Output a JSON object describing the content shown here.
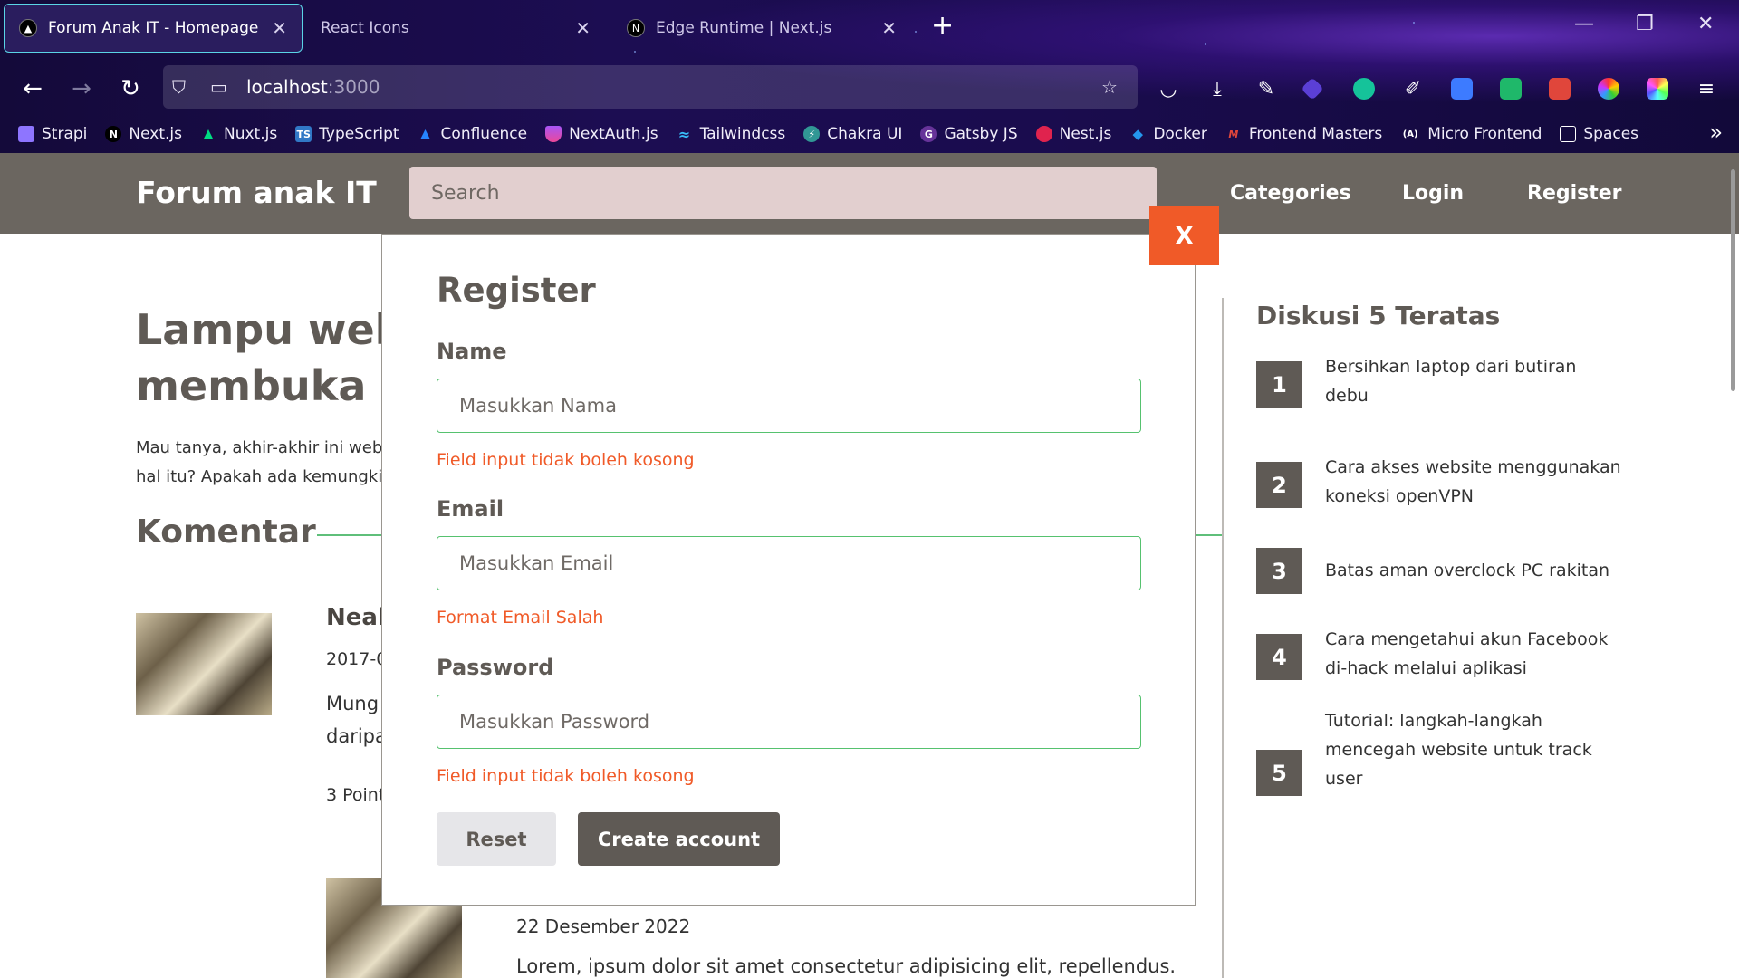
{
  "browser": {
    "tabs": [
      {
        "title": "Forum Anak IT - Homepage",
        "active": true
      },
      {
        "title": "React Icons",
        "active": false
      },
      {
        "title": "Edge Runtime | Next.js",
        "active": false
      }
    ],
    "url_host": "localhost",
    "url_port": ":3000",
    "bookmarks": [
      {
        "label": "Strapi",
        "icon": "strapi-icon",
        "color": "#8e75ff"
      },
      {
        "label": "Next.js",
        "icon": "nextjs-icon",
        "color": "#000000"
      },
      {
        "label": "Nuxt.js",
        "icon": "nuxt-icon",
        "color": "#00dc82"
      },
      {
        "label": "TypeScript",
        "icon": "typescript-icon",
        "color": "#3178c6"
      },
      {
        "label": "Confluence",
        "icon": "confluence-icon",
        "color": "#2684ff"
      },
      {
        "label": "NextAuth.js",
        "icon": "nextauth-icon",
        "color": "#a855f7"
      },
      {
        "label": "Tailwindcss",
        "icon": "tailwind-icon",
        "color": "#38bdf8"
      },
      {
        "label": "Chakra UI",
        "icon": "chakra-icon",
        "color": "#319795"
      },
      {
        "label": "Gatsby JS",
        "icon": "gatsby-icon",
        "color": "#663399"
      },
      {
        "label": "Nest.js",
        "icon": "nestjs-icon",
        "color": "#e0234e"
      },
      {
        "label": "Docker",
        "icon": "docker-icon",
        "color": "#2496ed"
      },
      {
        "label": "Frontend Masters",
        "icon": "frontend-masters-icon",
        "color": "#c02d28"
      },
      {
        "label": "Micro Frontend",
        "icon": "micro-frontend-icon",
        "color": "#444444"
      },
      {
        "label": "Spaces",
        "icon": "folder-icon",
        "color": "#ffffff"
      }
    ]
  },
  "site": {
    "brand": "Forum anak IT",
    "search_placeholder": "Search",
    "nav": [
      "Categories",
      "Login",
      "Register"
    ]
  },
  "article": {
    "title_line1": "Lampu webca",
    "title_line2": "membuka apl",
    "body_line1": "Mau tanya, akhir-akhir ini web",
    "body_line2": "hal itu? Apakah ada kemungki"
  },
  "comments": {
    "heading": "Komentar",
    "first": {
      "name": "Neal",
      "date": "2017-0",
      "text_line1": "Mung",
      "text_line2": "daripa",
      "points": "3 Point"
    },
    "second": {
      "date": "22 Desember 2022",
      "text": "Lorem, ipsum dolor sit amet consectetur adipisicing elit, repellendus."
    }
  },
  "sidebar": {
    "title": "Diskusi 5 Teratas",
    "items": [
      {
        "num": "1",
        "text": "Bersihkan laptop dari butiran debu"
      },
      {
        "num": "2",
        "text": "Cara akses website menggunakan koneksi openVPN"
      },
      {
        "num": "3",
        "text": "Batas aman overclock PC rakitan"
      },
      {
        "num": "4",
        "text": "Cara mengetahui akun Facebook di-hack melalui aplikasi"
      },
      {
        "num": "5",
        "text": "Tutorial: langkah-langkah mencegah website untuk track user"
      }
    ]
  },
  "modal": {
    "close_label": "X",
    "title": "Register",
    "name_label": "Name",
    "name_placeholder": "Masukkan Nama",
    "name_error": "Field input tidak boleh kosong",
    "email_label": "Email",
    "email_placeholder": "Masukkan Email",
    "email_error": "Format Email Salah",
    "password_label": "Password",
    "password_placeholder": "Masukkan Password",
    "password_error": "Field input tidak boleh kosong",
    "reset_label": "Reset",
    "create_label": "Create account"
  },
  "colors": {
    "accent_orange": "#f05a28",
    "header_bg": "#6b6660",
    "input_border": "#56c26f",
    "primary_text": "#5f5a55"
  }
}
